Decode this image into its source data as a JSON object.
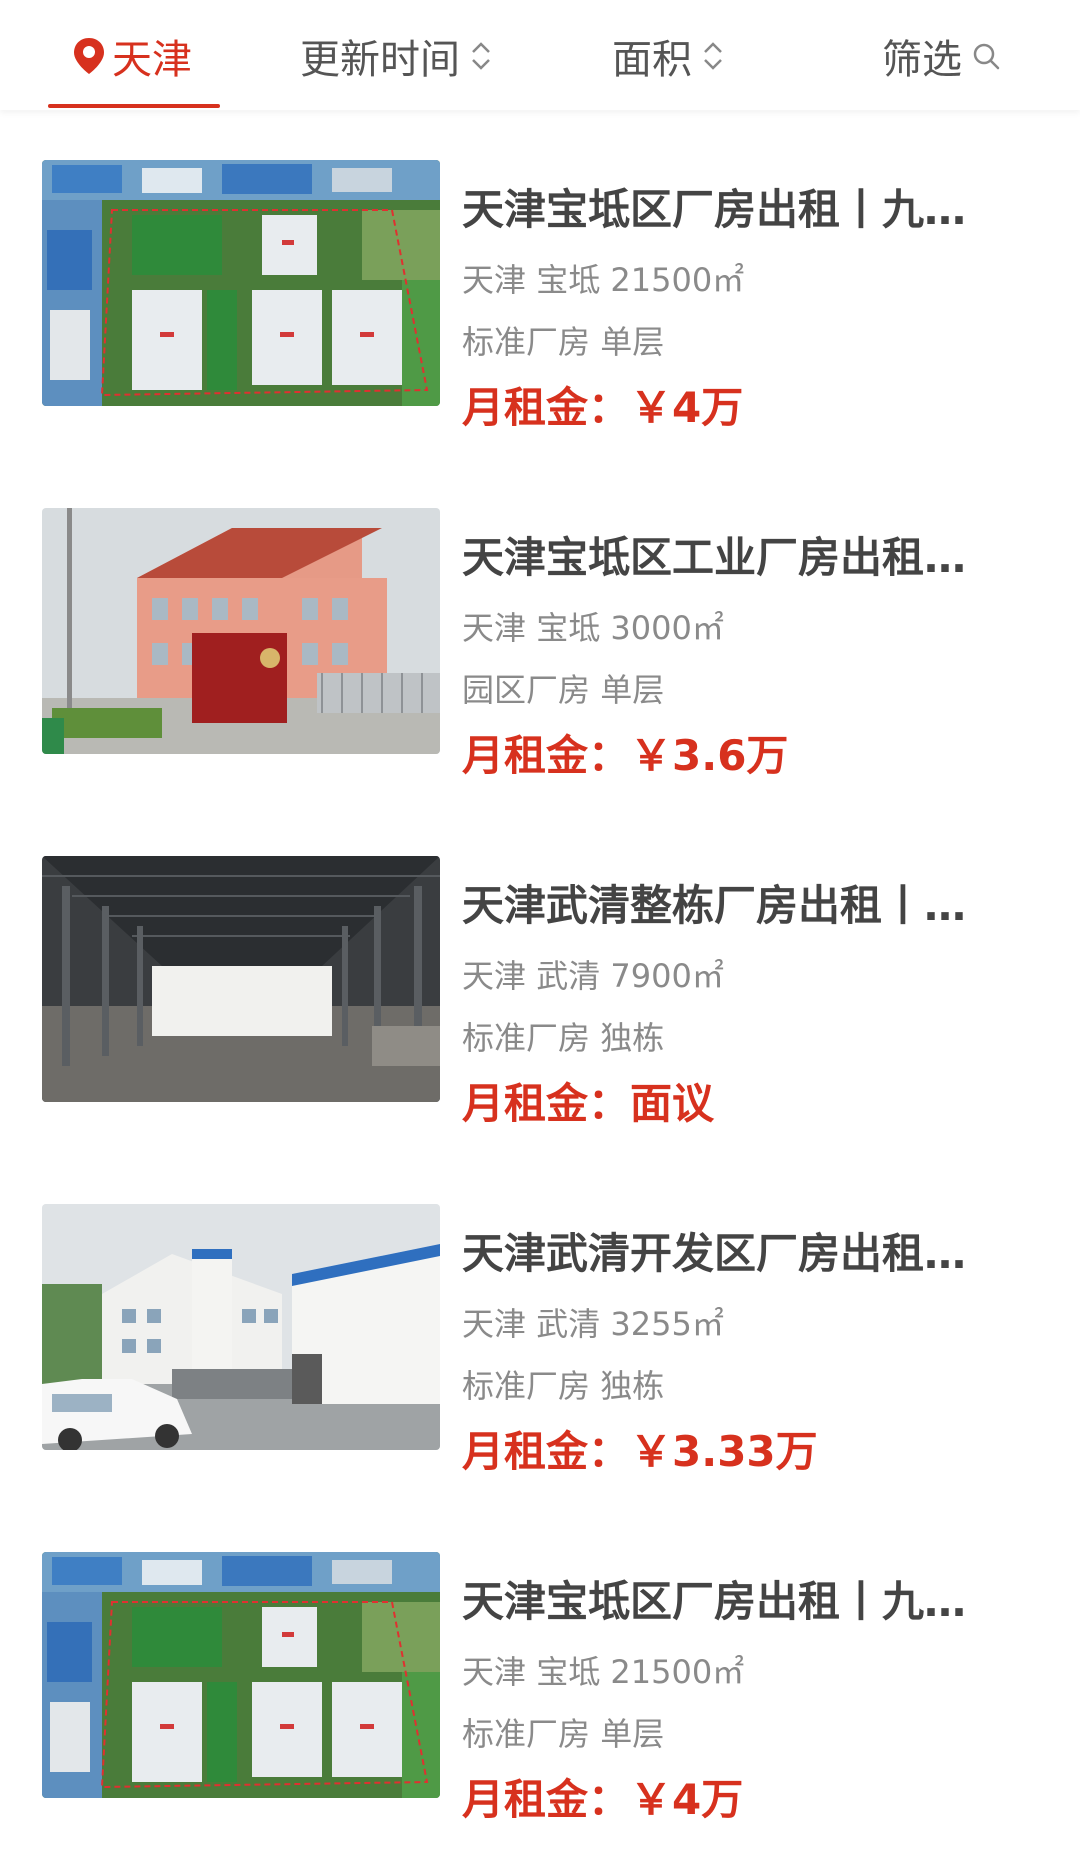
{
  "filter_bar": {
    "city": "天津",
    "sort_time": "更新时间",
    "sort_area": "面积",
    "filter": "筛选"
  },
  "colors": {
    "accent": "#d7311e",
    "title_text": "#444444",
    "secondary_text": "#8a8a8a"
  },
  "listings": [
    {
      "title": "天津宝坻区厂房出租丨九…",
      "city": "天津",
      "district": "宝坻",
      "area": "21500㎡",
      "category": "标准厂房",
      "floor": "单层",
      "price_label": "月租金：",
      "price": "￥4万",
      "image": "aerial-industrial-park"
    },
    {
      "title": "天津宝坻区工业厂房出租…",
      "city": "天津",
      "district": "宝坻",
      "area": "3000㎡",
      "category": "园区厂房",
      "floor": "单层",
      "price_label": "月租金：",
      "price": "￥3.6万",
      "image": "pink-office-building"
    },
    {
      "title": "天津武清整栋厂房出租丨…",
      "city": "天津",
      "district": "武清",
      "area": "7900㎡",
      "category": "标准厂房",
      "floor": "独栋",
      "price_label": "月租金：",
      "price": "面议",
      "image": "steel-warehouse-interior"
    },
    {
      "title": "天津武清开发区厂房出租…",
      "city": "天津",
      "district": "武清",
      "area": "3255㎡",
      "category": "标准厂房",
      "floor": "独栋",
      "price_label": "月租金：",
      "price": "￥3.33万",
      "image": "white-office-building-with-car"
    },
    {
      "title": "天津宝坻区厂房出租丨九…",
      "city": "天津",
      "district": "宝坻",
      "area": "21500㎡",
      "category": "标准厂房",
      "floor": "单层",
      "price_label": "月租金：",
      "price": "￥4万",
      "image": "aerial-industrial-park"
    }
  ]
}
